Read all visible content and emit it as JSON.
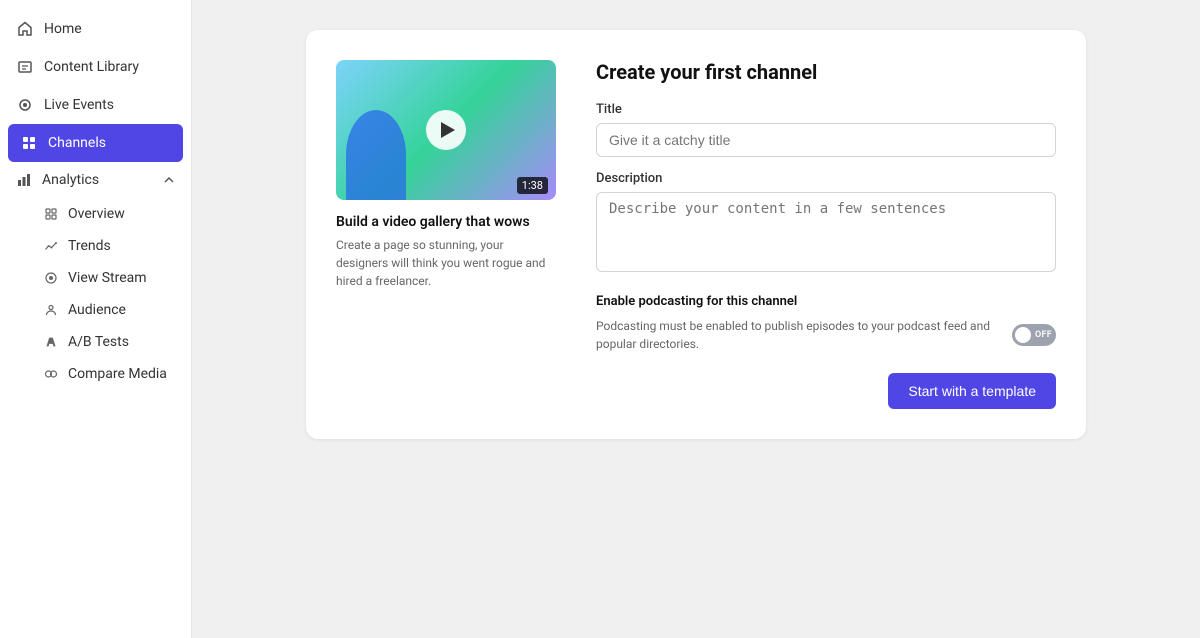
{
  "sidebar": {
    "items": [
      {
        "id": "home",
        "label": "Home",
        "icon": "home-icon",
        "active": false
      },
      {
        "id": "content-library",
        "label": "Content Library",
        "icon": "content-library-icon",
        "active": false
      },
      {
        "id": "live-events",
        "label": "Live Events",
        "icon": "live-events-icon",
        "active": false
      },
      {
        "id": "channels",
        "label": "Channels",
        "icon": "channels-icon",
        "active": true
      }
    ],
    "analytics": {
      "label": "Analytics",
      "icon": "analytics-icon",
      "subitems": [
        {
          "id": "overview",
          "label": "Overview",
          "icon": "overview-icon"
        },
        {
          "id": "trends",
          "label": "Trends",
          "icon": "trends-icon"
        },
        {
          "id": "view-stream",
          "label": "View Stream",
          "icon": "view-stream-icon"
        },
        {
          "id": "audience",
          "label": "Audience",
          "icon": "audience-icon"
        },
        {
          "id": "ab-tests",
          "label": "A/B Tests",
          "icon": "ab-tests-icon"
        },
        {
          "id": "compare-media",
          "label": "Compare Media",
          "icon": "compare-media-icon"
        }
      ]
    }
  },
  "preview": {
    "duration": "1:38",
    "title": "Build a video gallery that wows",
    "description": "Create a page so stunning, your designers will think you went rogue and hired a freelancer."
  },
  "form": {
    "heading": "Create your first channel",
    "title_label": "Title",
    "title_placeholder": "Give it a catchy title",
    "description_label": "Description",
    "description_placeholder": "Describe your content in a few sentences",
    "podcast_heading": "Enable podcasting for this channel",
    "podcast_description": "Podcasting must be enabled to publish episodes to your podcast feed and popular directories.",
    "toggle_label": "OFF",
    "submit_label": "Start with a template"
  }
}
